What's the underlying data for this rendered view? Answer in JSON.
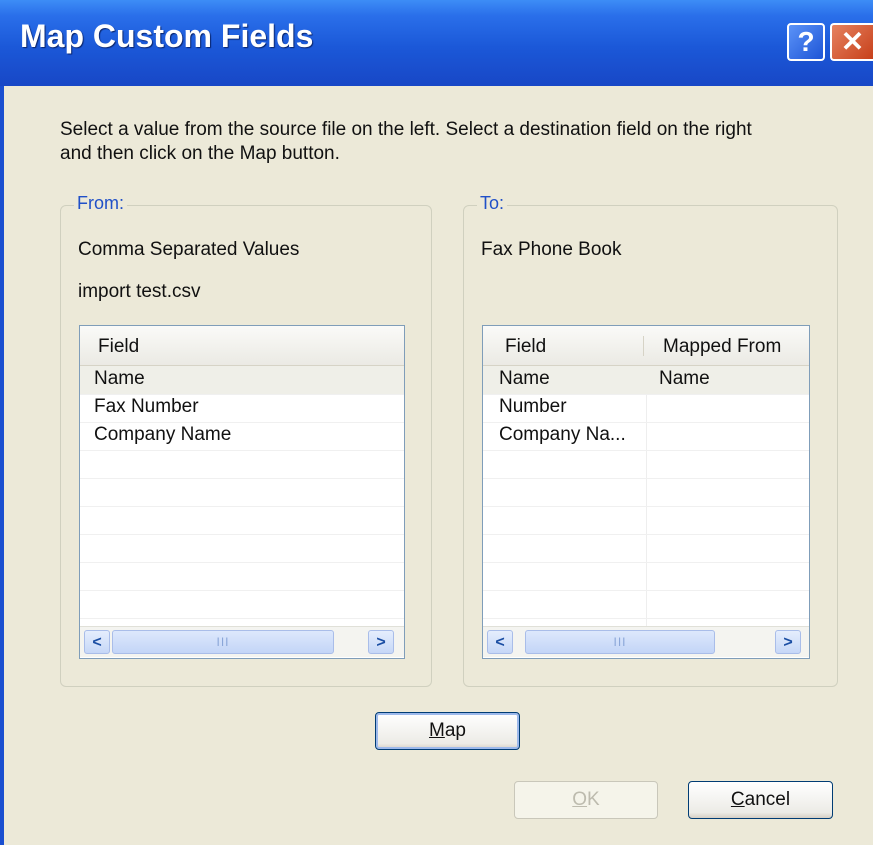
{
  "window": {
    "title": "Map Custom Fields"
  },
  "titlebar": {
    "help_glyph": "?",
    "close_glyph": "✕"
  },
  "instruction_line1": "Select a value from the source file on the left. Select a destination field on the right",
  "instruction_line2": "and then click on the Map button.",
  "from_group": {
    "legend": "From:",
    "source_type": "Comma Separated Values",
    "file_name": "import test.csv",
    "list": {
      "columns": [
        "Field"
      ],
      "rows": [
        "Name",
        "Fax Number",
        "Company Name"
      ],
      "selected_index": 0
    }
  },
  "to_group": {
    "legend": "To:",
    "dest_type": "Fax Phone Book",
    "list": {
      "columns": [
        "Field",
        "Mapped From"
      ],
      "rows": [
        {
          "field": "Name",
          "mapped_from": "Name"
        },
        {
          "field": "Number",
          "mapped_from": ""
        },
        {
          "field": "Company Na...",
          "mapped_from": ""
        }
      ],
      "selected_index": 0
    }
  },
  "scrollbar": {
    "left_arrow": "<",
    "right_arrow": ">",
    "grip": "III"
  },
  "buttons": {
    "map": {
      "mnemonic": "M",
      "rest": "ap"
    },
    "ok": {
      "mnemonic": "O",
      "rest": "K",
      "enabled": false
    },
    "cancel": {
      "mnemonic": "C",
      "rest": "ancel"
    }
  },
  "colors": {
    "titlebar": "#1b58d8",
    "legend": "#2050c8",
    "face": "#ece9d8"
  },
  "icons": [
    "help-icon",
    "close-icon",
    "scroll-left-icon",
    "scroll-right-icon"
  ]
}
